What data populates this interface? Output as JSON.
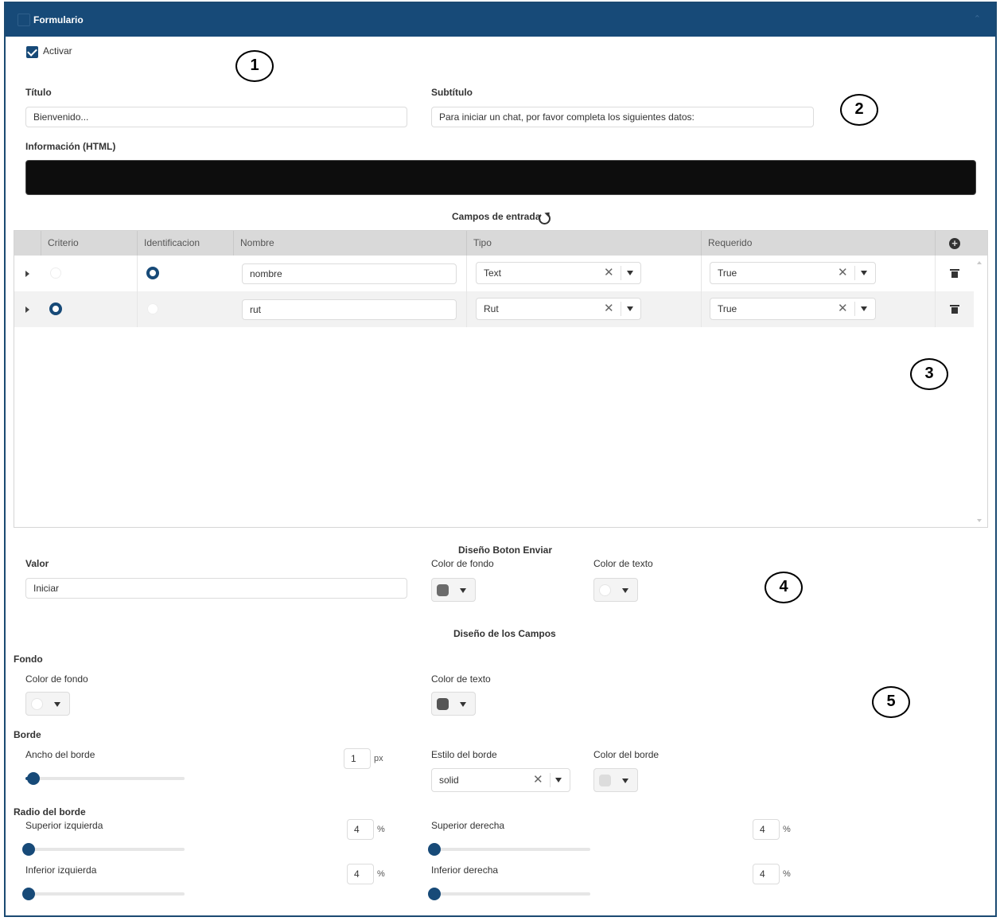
{
  "header": {
    "title": "Formulario"
  },
  "activar": {
    "label": "Activar",
    "checked": true
  },
  "titulo": {
    "label": "Título",
    "value": "Bienvenido..."
  },
  "subtitulo": {
    "label": "Subtítulo",
    "value": "Para iniciar un chat, por favor completa los siguientes datos:"
  },
  "informacion": {
    "label": "Información (HTML)"
  },
  "campos": {
    "title": "Campos de entrada",
    "columns": [
      "Criterio",
      "Identificacion",
      "Nombre",
      "Tipo",
      "Requerido"
    ],
    "rows": [
      {
        "criterio": false,
        "identificacion": true,
        "nombre": "nombre",
        "tipo": "Text",
        "requerido": "True"
      },
      {
        "criterio": true,
        "identificacion": false,
        "nombre": "rut",
        "tipo": "Rut",
        "requerido": "True"
      }
    ]
  },
  "boton": {
    "title": "Diseño Boton Enviar",
    "valor_label": "Valor",
    "valor": "Iniciar",
    "color_fondo_label": "Color de fondo",
    "color_fondo": "#6b6b6b",
    "color_texto_label": "Color de texto",
    "color_texto": "#ffffff"
  },
  "campos_diseno": {
    "title": "Diseño de los Campos",
    "fondo": {
      "label": "Fondo",
      "color_fondo_label": "Color de fondo",
      "color_fondo": "#ffffff",
      "color_texto_label": "Color de texto",
      "color_texto": "#555555"
    },
    "borde": {
      "label": "Borde",
      "ancho_label": "Ancho del borde",
      "ancho": "1",
      "ancho_unit": "px",
      "estilo_label": "Estilo del borde",
      "estilo": "solid",
      "color_label": "Color del borde",
      "color": "#dcdcdc"
    },
    "radio": {
      "label": "Radio del borde",
      "sup_izq_label": "Superior izquierda",
      "sup_izq": "4",
      "sup_der_label": "Superior derecha",
      "sup_der": "4",
      "inf_izq_label": "Inferior izquierda",
      "inf_izq": "4",
      "inf_der_label": "Inferior derecha",
      "inf_der": "4",
      "unit": "%"
    }
  },
  "callouts": [
    "1",
    "2",
    "3",
    "4",
    "5"
  ]
}
